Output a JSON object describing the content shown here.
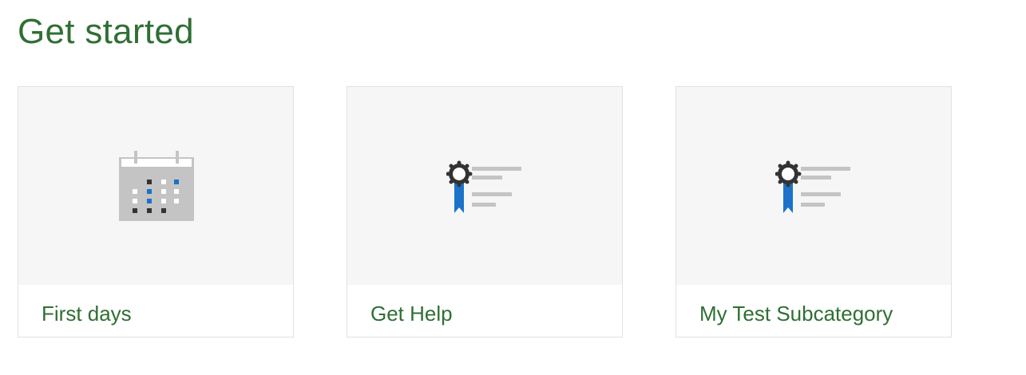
{
  "page": {
    "title": "Get started"
  },
  "colors": {
    "title_green": "#2f6f33",
    "tile_background": "#f6f6f6",
    "tile_border": "#e1e1e1",
    "icon_gray": "#c4c4c4",
    "icon_blue": "#1a73c8",
    "icon_dark": "#333333"
  },
  "cards": [
    {
      "label": "First days",
      "icon": "calendar-icon"
    },
    {
      "label": "Get Help",
      "icon": "certificate-icon"
    },
    {
      "label": "My Test Subcategory",
      "icon": "certificate-icon"
    }
  ]
}
